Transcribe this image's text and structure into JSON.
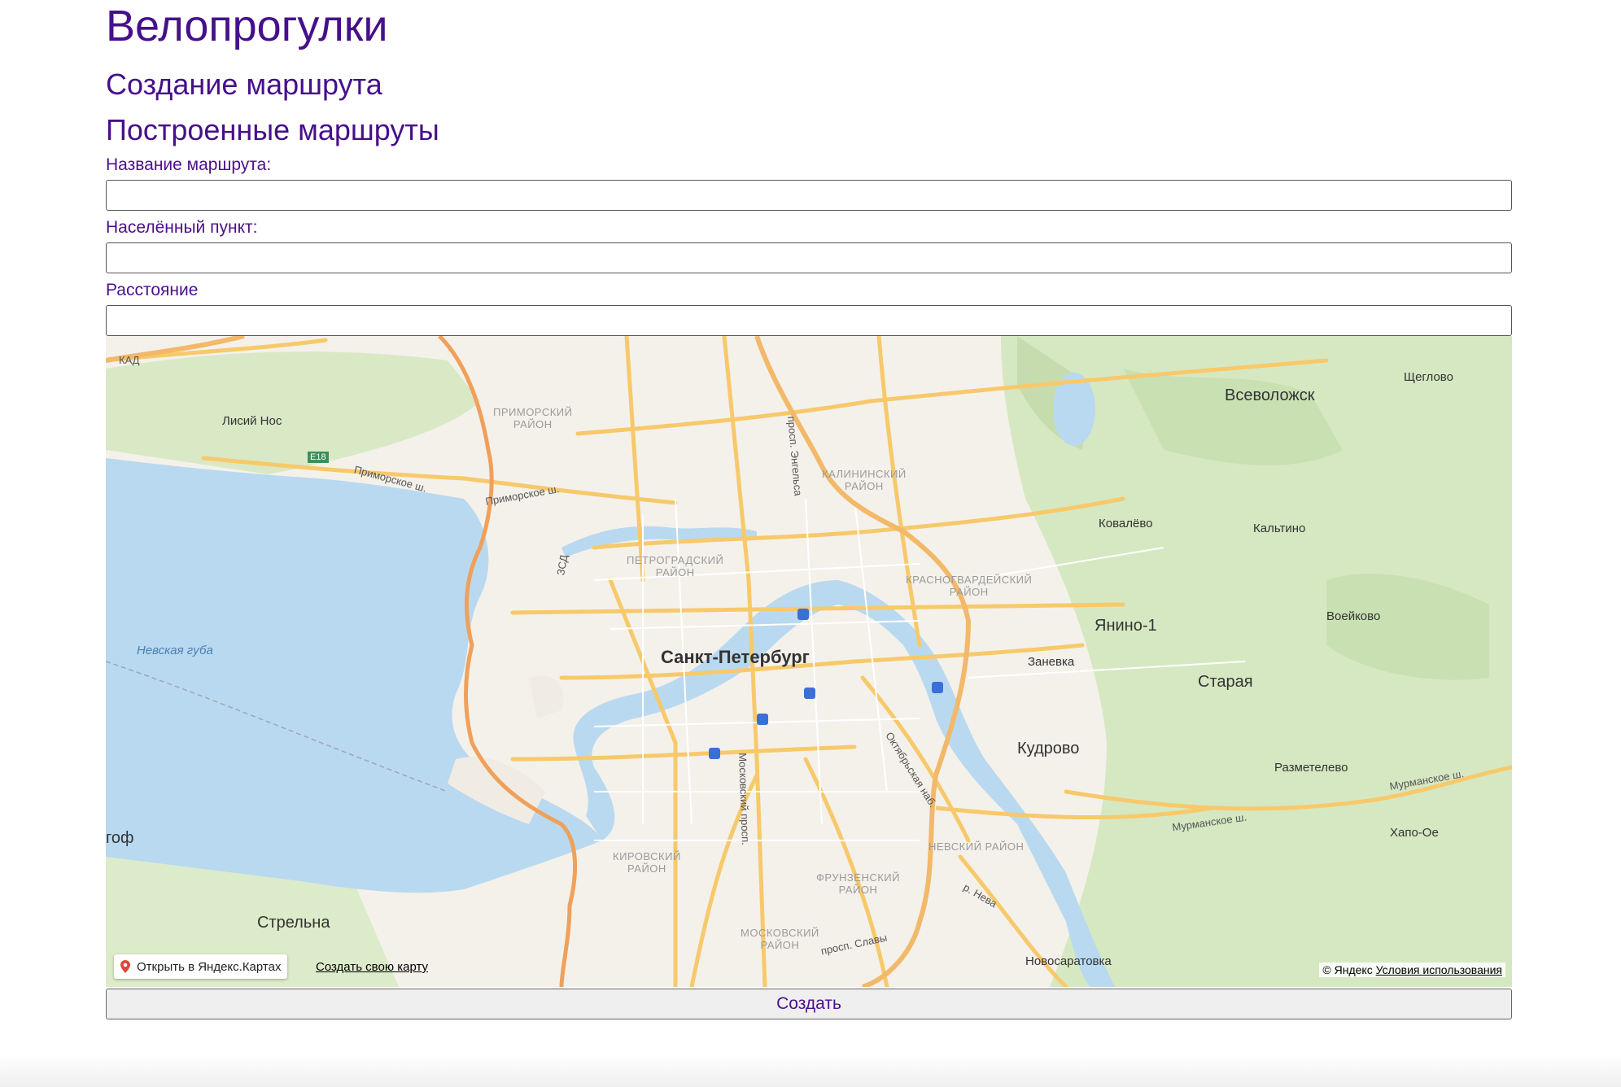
{
  "header": {
    "site_title": "Велопрогулки",
    "nav_create": "Создание маршрута",
    "nav_routes": "Построенные маршруты"
  },
  "form": {
    "name_label": "Название маршрута:",
    "name_value": "",
    "city_label": "Населённый пункт:",
    "city_value": "",
    "distance_label": "Расстояние",
    "distance_value": "",
    "submit_label": "Создать"
  },
  "map": {
    "labels": {
      "city_main": "Санкт-Петербург",
      "vsevolozhsk": "Всеволожск",
      "shcheglovo": "Щеглово",
      "lisiy_nos": "Лисий Нос",
      "primorsky": "ПРИМОРСКИЙ\nРАЙОН",
      "kalininsky": "КАЛИНИНСКИЙ\nРАЙОН",
      "petrogradsky": "ПЕТРОГРАДСКИЙ\nРАЙОН",
      "krasnogvardeysky": "КРАСНОГВАРДЕЙСКИЙ\nРАЙОН",
      "kirovsky": "КИРОВСКИЙ\nРАЙОН",
      "frunzensky": "ФРУНЗЕНСКИЙ\nРАЙОН",
      "moskovsky": "МОСКОВСКИЙ\nРАЙОН",
      "nevsky": "НЕВСКИЙ РАЙОН",
      "nevskaya_guba": "Невская губа",
      "kovalevo": "Ковалёво",
      "kaltino": "Кальтино",
      "yanino": "Янино-1",
      "voeykovo": "Воейково",
      "zanevka": "Заневка",
      "staraya": "Старая",
      "kudrovo": "Кудрово",
      "razmetelevo": "Разметелево",
      "khapo_oe": "Хапо-Ое",
      "strelna": "Стрельна",
      "novosaratovka": "Новосаратовка",
      "petergof_part": "гоф",
      "primorskoe_sh_1": "Приморское ш.",
      "primorskoe_sh_2": "Приморское ш.",
      "murmanskoe_sh_1": "Мурманское ш.",
      "murmanskoe_sh_2": "Мурманское ш.",
      "engelsa": "просп. Энгельса",
      "moskovsky_prosp": "Московский просп.",
      "oktyabrskaya": "Октябрьская наб.",
      "slavy": "просп. Славы",
      "neva": "р. Нева",
      "e18": "E18",
      "kad": "КАД",
      "zsd": "ЗСД"
    },
    "open_in_yandex": "Открыть в Яндекс.Картах",
    "create_own_map": "Создать свою карту",
    "copyright": "© Яндекс",
    "terms": "Условия использования"
  },
  "colors": {
    "accent_text": "#4b0f8a",
    "water": "#b9d9f0",
    "forest": "#d8e8c4",
    "road_major": "#f7c96b",
    "road_ring": "#f2a55a"
  }
}
